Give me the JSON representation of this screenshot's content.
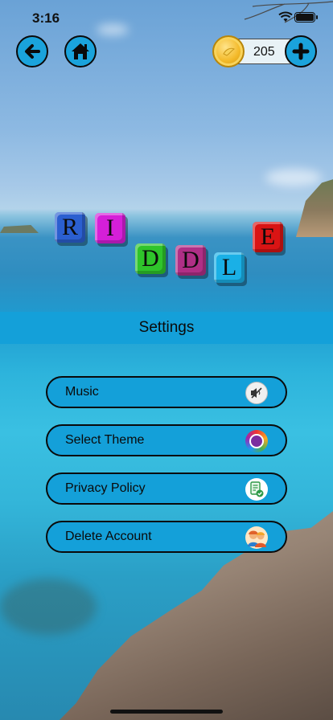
{
  "status_bar": {
    "time": "3:16"
  },
  "top_bar": {
    "coins": "205",
    "back_icon": "arrow-left-icon",
    "home_icon": "home-icon",
    "coin_icon": "coin-icon",
    "plus_icon": "plus-icon"
  },
  "logo": {
    "letters": [
      {
        "char": "R",
        "color": "#2b5fd0"
      },
      {
        "char": "I",
        "color": "#d51fd8"
      },
      {
        "char": "D",
        "color": "#2fc42b"
      },
      {
        "char": "D",
        "color": "#b02f86"
      },
      {
        "char": "L",
        "color": "#1ab0e6"
      },
      {
        "char": "E",
        "color": "#d91414"
      }
    ]
  },
  "settings": {
    "title": "Settings",
    "items": [
      {
        "label": "Music",
        "icon": "muted-speaker-icon"
      },
      {
        "label": "Select Theme",
        "icon": "theme-palette-icon"
      },
      {
        "label": "Privacy Policy",
        "icon": "privacy-document-icon"
      },
      {
        "label": "Delete Account",
        "icon": "account-avatar-icon"
      }
    ]
  },
  "colors": {
    "accent": "#14a0d9",
    "outline": "#0a0a0a"
  }
}
